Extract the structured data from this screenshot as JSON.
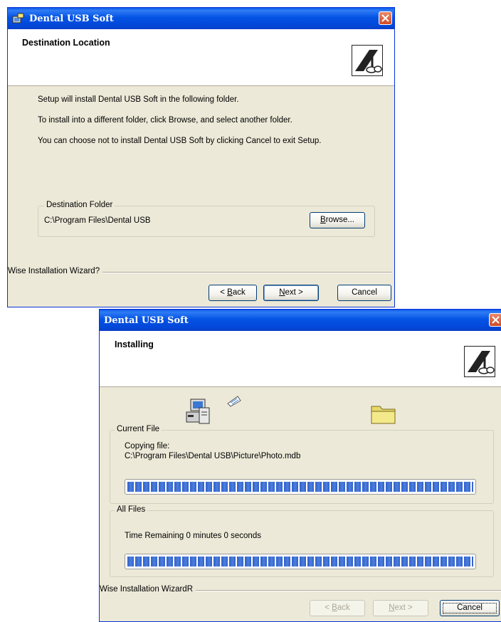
{
  "dialog1": {
    "title": "Dental USB Soft",
    "header_title": "Destination Location",
    "lines": [
      "Setup will install Dental USB Soft in the following folder.",
      "To install into a different folder, click Browse, and select another folder.",
      "You can choose not to install Dental USB Soft by clicking Cancel to exit Setup."
    ],
    "groupbox_label": "Destination Folder",
    "folder_path": "C:\\Program Files\\Dental USB",
    "browse_label": "rowse...",
    "browse_mnemonic": "B",
    "footer_label": "Wise Installation Wizard?",
    "back_prefix": "< ",
    "back_mnemonic": "B",
    "back_rest": "ack",
    "next_mnemonic": "N",
    "next_rest": "ext >",
    "cancel_label": "Cancel"
  },
  "dialog2": {
    "title": "Dental USB Soft",
    "header_title": "Installing",
    "current_file_label": "Current File",
    "copying_label": "Copying file:",
    "copying_path": "C:\\Program Files\\Dental USB\\Picture\\Photo.mdb",
    "current_progress": 1.0,
    "all_files_label": "All Files",
    "time_remaining": "Time Remaining 0 minutes 0 seconds",
    "all_progress": 1.0,
    "footer_label": "Wise Installation WizardR",
    "back_prefix": "< ",
    "back_mnemonic": "B",
    "back_rest": "ack",
    "next_mnemonic": "N",
    "next_rest": "ext >",
    "cancel_label": "Cancel"
  },
  "colors": {
    "title_bar": "#0453e4",
    "progress": "#3160c9",
    "close_button": "#d24a25",
    "dialog_face": "#ece9d8"
  },
  "icons": [
    "installer-app-icon",
    "close-icon",
    "wizard-logo-icon",
    "computer-setup-icon",
    "flying-page-icon",
    "folder-icon"
  ]
}
